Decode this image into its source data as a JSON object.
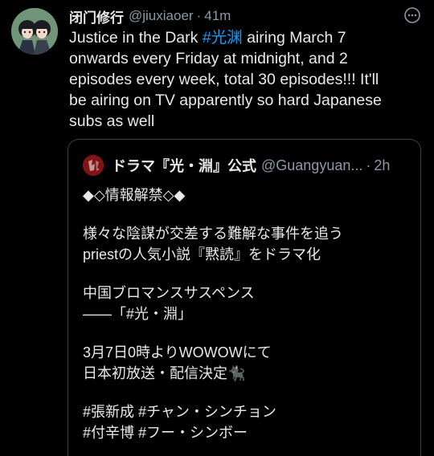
{
  "tweet": {
    "author_name": "闭门修行",
    "handle": "@jiuxiaoer",
    "separator": "·",
    "time": "41m",
    "avatar_icon": "illustrated-characters-avatar",
    "more_icon": "more-dots-icon",
    "text_lines": [
      {
        "before": "Justice in the Dark ",
        "hashtag": "#光渊",
        "after": " airing March 7"
      },
      {
        "text": "onwards every Friday at midnight, and 2"
      },
      {
        "text": "episodes every week, total 30 episodes!!! It'll"
      },
      {
        "text": "be airing on TV apparently so hard Japanese"
      },
      {
        "text": "subs as well"
      }
    ]
  },
  "quoted": {
    "author_name": "ドラマ『光・淵』公式",
    "handle": "@Guangyuan...",
    "separator": "·",
    "time": "2h",
    "body_lines": [
      "◆◇情報解禁◇◆",
      "",
      "様々な陰謀が交差する難解な事件を追う",
      "priestの人気小説『黙読』をドラマ化",
      "",
      "中国ブロマンスサスペンス",
      "――「#光・淵」",
      "",
      "3月7日0時よりWOWOWにて",
      "日本初放送・配信決定🐈‍⬛",
      "",
      "#張新成 #チャン・シンチョン",
      "#付辛博 #フー・シンボー"
    ]
  },
  "colors": {
    "background": "#000000",
    "text": "#e7e9ea",
    "secondary": "#8b98a5",
    "link": "#1d9bf0",
    "border": "#3e4144"
  }
}
